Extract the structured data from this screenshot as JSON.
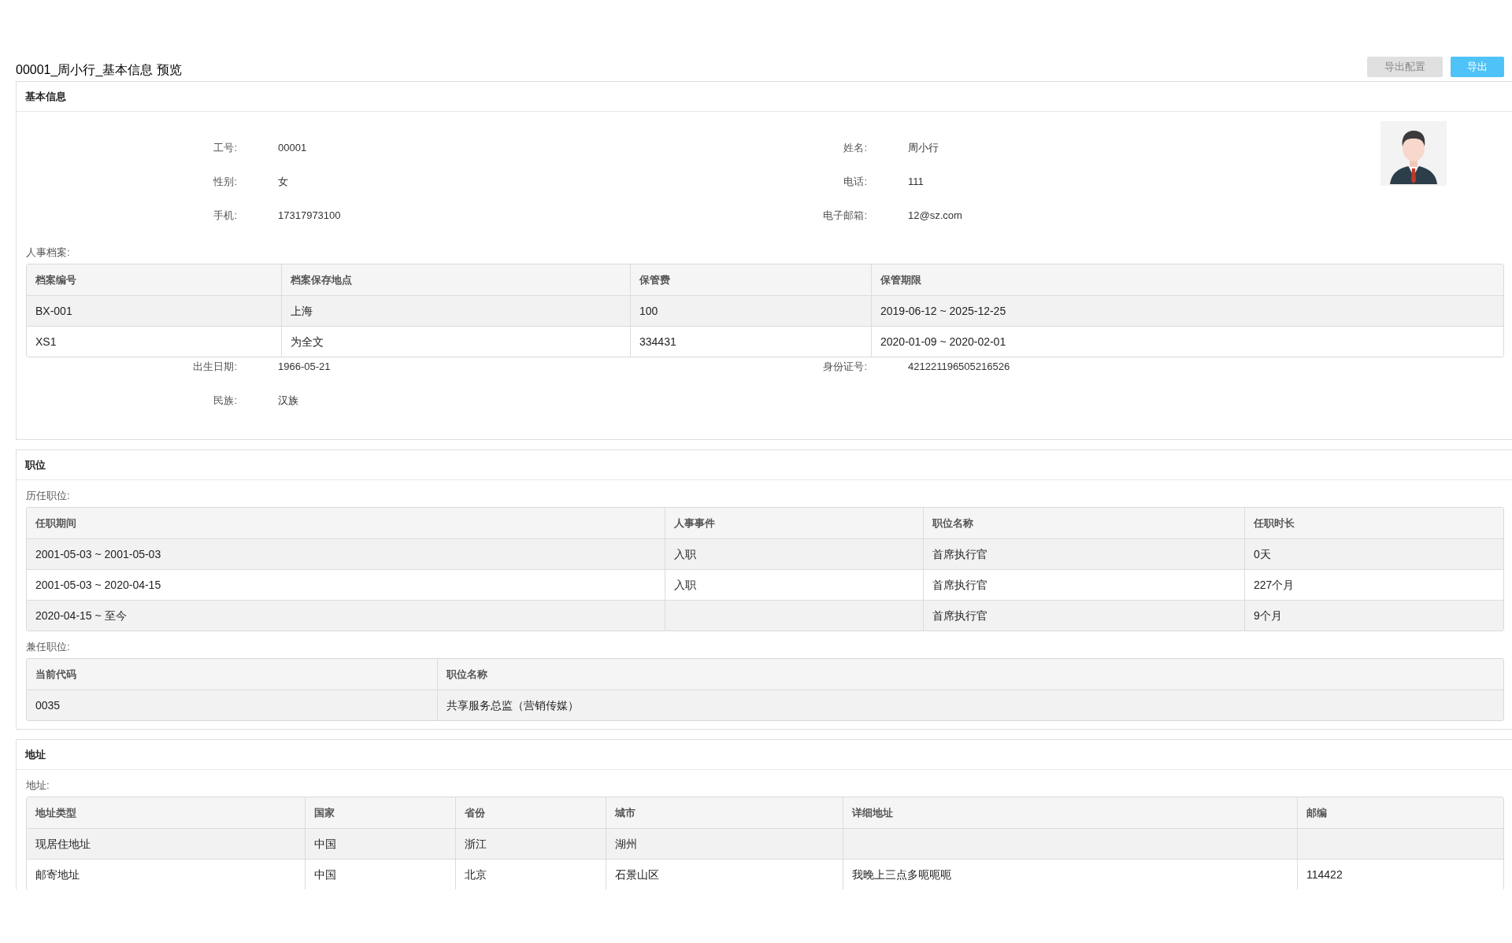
{
  "title": "00001_周小行_基本信息 预览",
  "buttons": [
    {
      "label": "导出配置",
      "kind": "secondary"
    },
    {
      "label": "导出",
      "kind": "primary"
    }
  ],
  "sections": [
    {
      "title": "基本信息",
      "blocks": [
        {
          "kind": "fields",
          "photo": true,
          "rows": [
            [
              {
                "label": "工号:",
                "value": "00001"
              },
              {
                "label": "姓名:",
                "value": "周小行"
              }
            ],
            [
              {
                "label": "性别:",
                "value": "女"
              },
              {
                "label": "电话:",
                "value": "111"
              }
            ],
            [
              {
                "label": "手机:",
                "value": "17317973100"
              },
              {
                "label": "电子邮箱:",
                "value": "12@sz.com"
              }
            ]
          ]
        },
        {
          "kind": "table",
          "label": "人事档案:",
          "columns": [
            "档案编号",
            "档案保存地点",
            "保管费",
            "保管期限"
          ],
          "rows": [
            [
              "BX-001",
              "上海",
              "100",
              "2019-06-12 ~ 2025-12-25"
            ],
            [
              "XS1",
              "为全文",
              "334431",
              "2020-01-09 ~ 2020-02-01"
            ]
          ]
        },
        {
          "kind": "fields",
          "photo": false,
          "rows": [
            [
              {
                "label": "出生日期:",
                "value": "1966-05-21"
              },
              {
                "label": "身份证号:",
                "value": "421221196505216526"
              }
            ],
            [
              {
                "label": "民族:",
                "value": "汉族"
              }
            ]
          ]
        }
      ]
    },
    {
      "title": "职位",
      "blocks": [
        {
          "kind": "table",
          "label": "历任职位:",
          "columns": [
            "任职期间",
            "人事事件",
            "职位名称",
            "任职时长"
          ],
          "rows": [
            [
              "2001-05-03 ~ 2001-05-03",
              "入职",
              "首席执行官",
              "0天"
            ],
            [
              "2001-05-03 ~ 2020-04-15",
              "入职",
              "首席执行官",
              "227个月"
            ],
            [
              "2020-04-15 ~ 至今",
              "",
              "首席执行官",
              "9个月"
            ]
          ]
        },
        {
          "kind": "table",
          "label": "兼任职位:",
          "columns": [
            "当前代码",
            "职位名称"
          ],
          "rows": [
            [
              "0035",
              "共享服务总监（营销传媒）"
            ]
          ]
        }
      ]
    },
    {
      "title": "地址",
      "blocks": [
        {
          "kind": "table",
          "label": "地址:",
          "columns": [
            "地址类型",
            "国家",
            "省份",
            "城市",
            "详细地址",
            "邮编"
          ],
          "rows": [
            [
              "现居住地址",
              "中国",
              "浙江",
              "湖州",
              "",
              ""
            ],
            [
              "邮寄地址",
              "中国",
              "北京",
              "石景山区",
              "我晚上三点多呃呃呃",
              "114422"
            ]
          ]
        }
      ]
    }
  ]
}
